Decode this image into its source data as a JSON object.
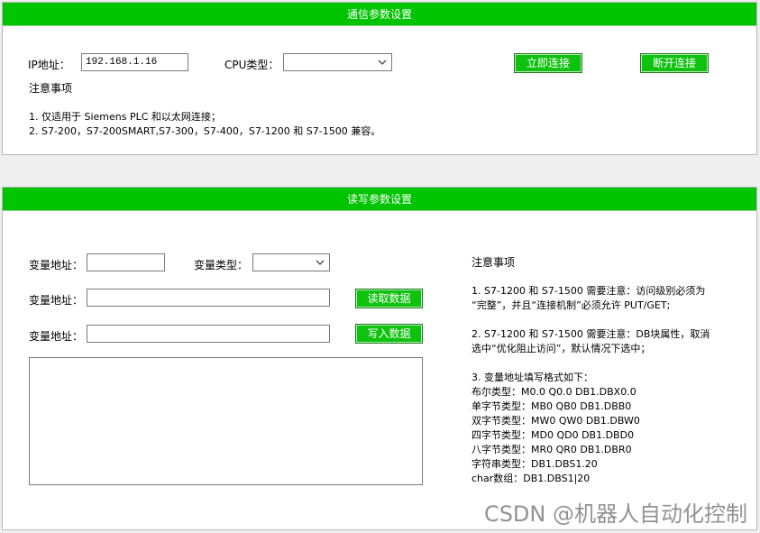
{
  "comm_panel": {
    "title": "通信参数设置",
    "ip_label": "IP地址：",
    "ip_value": "192.168.1.16",
    "cpu_label": "CPU类型：",
    "cpu_value": "",
    "connect_button": "立即连接",
    "disconnect_button": "断开连接",
    "notes_title": "注意事项",
    "notes": [
      "1. 仅适用于 Siemens PLC 和以太网连接；",
      "2. S7-200，S7-200SMART,S7-300，S7-400，S7-1200 和 S7-1500 兼容。"
    ]
  },
  "rw_panel": {
    "title": "读写参数设置",
    "var_addr_label_1": "变量地址：",
    "var_addr_value_1": "",
    "var_type_label": "变量类型：",
    "var_type_value": "",
    "var_addr_label_2": "变量地址：",
    "var_addr_value_2": "",
    "read_button": "读取数据",
    "var_addr_label_3": "变量地址：",
    "var_addr_value_3": "",
    "write_button": "写入数据",
    "output_value": "",
    "notes_title": "注意事项",
    "notes": [
      "1. S7-1200 和 S7-1500 需要注意：访问级别必须为",
      "“完整”，并且“连接机制”必须允许 PUT/GET;",
      "2. S7-1200 和 S7-1500 需要注意：DB块属性，取消",
      "选中“优化阻止访问”，默认情况下选中；",
      "3. 变量地址填写格式如下：",
      "布尔类型：M0.0 Q0.0 DB1.DBX0.0",
      "单字节类型：MB0 QB0 DB1.DBB0",
      "双字节类型：MW0 QW0 DB1.DBW0",
      "四字节类型：MD0 QD0 DB1.DBD0",
      "八字节类型：MR0 QR0 DB1.DBR0",
      "字符串类型：DB1.DBS1.20",
      "char数组：DB1.DBS1|20"
    ]
  },
  "watermark": "CSDN @机器人自动化控制",
  "colors": {
    "header_green": "#00c400",
    "button_green": "#0fc20f",
    "page_bg": "#efefef"
  }
}
